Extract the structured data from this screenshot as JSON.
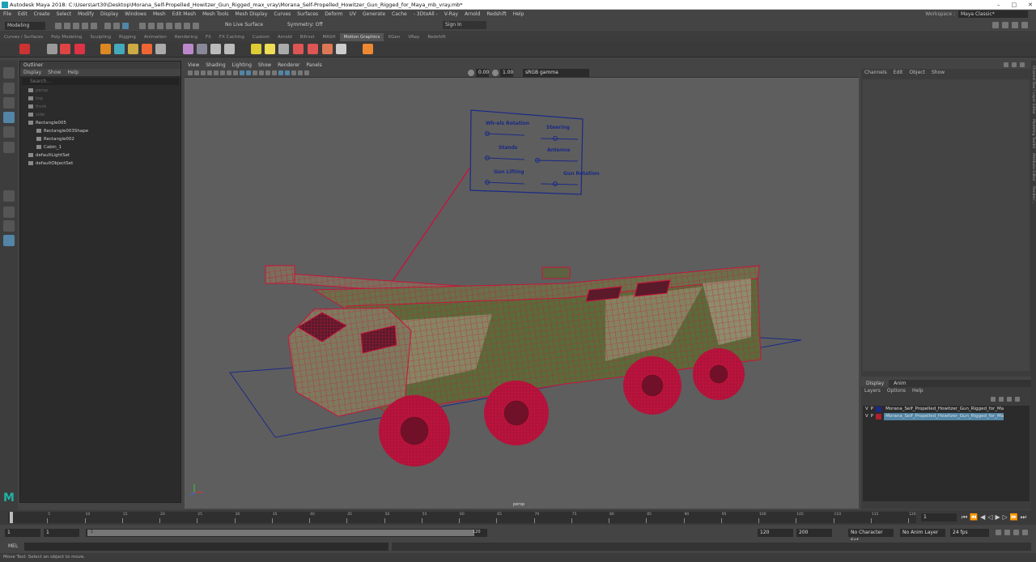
{
  "window": {
    "title": "Autodesk Maya 2018: C:\\Users\\art30\\Desktop\\Morana_Self-Propelled_Howitzer_Gun_Rigged_max_vray\\Morana_Self-Propelled_Howitzer_Gun_Rigged_for_Maya_mb_vray.mb*"
  },
  "menubar": [
    "File",
    "Edit",
    "Create",
    "Select",
    "Modify",
    "Display",
    "Windows",
    "Mesh",
    "Edit Mesh",
    "Mesh Tools",
    "Mesh Display",
    "Curves",
    "Surfaces",
    "Deform",
    "UV",
    "Generate",
    "Cache",
    "- 3DtoAll -",
    "V-Ray",
    "Arnold",
    "Redshift",
    "Help"
  ],
  "workspace": {
    "label": "Workspace :",
    "value": "Maya Classic*"
  },
  "statusline": {
    "mode": "Modeling",
    "live_surface": "No Live Surface",
    "symmetry": "Symmetry: Off",
    "sign_in": "Sign In"
  },
  "shelf_tabs": [
    "Curves / Surfaces",
    "Poly Modeling",
    "Sculpting",
    "Rigging",
    "Animation",
    "Rendering",
    "FX",
    "FX Caching",
    "Custom",
    "Arnold",
    "Bifrost",
    "MASH",
    "Motion Graphics",
    "XGen",
    "VRay",
    "Redshift"
  ],
  "shelf_active": "Motion Graphics",
  "outliner": {
    "title": "Outliner",
    "menu": [
      "Display",
      "Show",
      "Help"
    ],
    "search_placeholder": "Search...",
    "items": [
      {
        "label": "persp",
        "dim": true,
        "indent": 1
      },
      {
        "label": "top",
        "dim": true,
        "indent": 1
      },
      {
        "label": "front",
        "dim": true,
        "indent": 1
      },
      {
        "label": "side",
        "dim": true,
        "indent": 1
      },
      {
        "label": "Rectangle005",
        "dim": false,
        "indent": 1
      },
      {
        "label": "Rectangle003Shape",
        "dim": false,
        "indent": 2
      },
      {
        "label": "Rectangle002",
        "dim": false,
        "indent": 2
      },
      {
        "label": "Cabin_1",
        "dim": false,
        "indent": 2
      },
      {
        "label": "defaultLightSet",
        "dim": false,
        "indent": 1
      },
      {
        "label": "defaultObjectSet",
        "dim": false,
        "indent": 1
      }
    ]
  },
  "viewport": {
    "menu": [
      "View",
      "Shading",
      "Lighting",
      "Show",
      "Renderer",
      "Panels"
    ],
    "exposure": "0.00",
    "gamma": "1.00",
    "color_space": "sRGB gamma",
    "camera_label": "persp",
    "control_panel": [
      "Wh-els Rotation",
      "Steering",
      "Stands",
      "Antenna",
      "Gun Lifting",
      "Gun Rotation"
    ]
  },
  "channelbox": {
    "menu": [
      "Channels",
      "Edit",
      "Object",
      "Show"
    ]
  },
  "layers": {
    "tabs": [
      "Display",
      "Anim"
    ],
    "menu": [
      "Layers",
      "Options",
      "Help"
    ],
    "rows": [
      {
        "v": "V",
        "p": "P",
        "name": "Morana_Self_Propelled_Howitzer_Gun_Rigged_for_Maya",
        "color": "#1b2a86",
        "selected": false
      },
      {
        "v": "V",
        "p": "P",
        "name": "Morana_Self_Propelled_Howitzer_Gun_Rigged_for_Maya",
        "color": "#b0202e",
        "selected": true
      }
    ]
  },
  "side_tabs": [
    "Channel Box / Layer Editor",
    "Modeling Toolkit",
    "Attribute Editor",
    "Render/..."
  ],
  "timeline": {
    "ticks": [
      "1",
      "5",
      "10",
      "15",
      "20",
      "25",
      "30",
      "35",
      "40",
      "45",
      "50",
      "55",
      "60",
      "65",
      "70",
      "75",
      "80",
      "85",
      "90",
      "95",
      "100",
      "105",
      "110",
      "115",
      "120"
    ],
    "current_frame": "1"
  },
  "range": {
    "start": "1",
    "inner_start": "1",
    "slider_start": "1",
    "slider_end": "120",
    "inner_end": "120",
    "end": "200",
    "character_set": "No Character Set",
    "anim_layer": "No Anim Layer",
    "fps": "24 fps"
  },
  "cmdline": {
    "label": "MEL"
  },
  "helpline": "Move Tool: Select an object to move.",
  "colors": {
    "wireframe": "#c8143c",
    "camo_green": "#5a6b3a",
    "camo_tan": "#8f8a6a",
    "selected_blue": "#5285a6"
  }
}
